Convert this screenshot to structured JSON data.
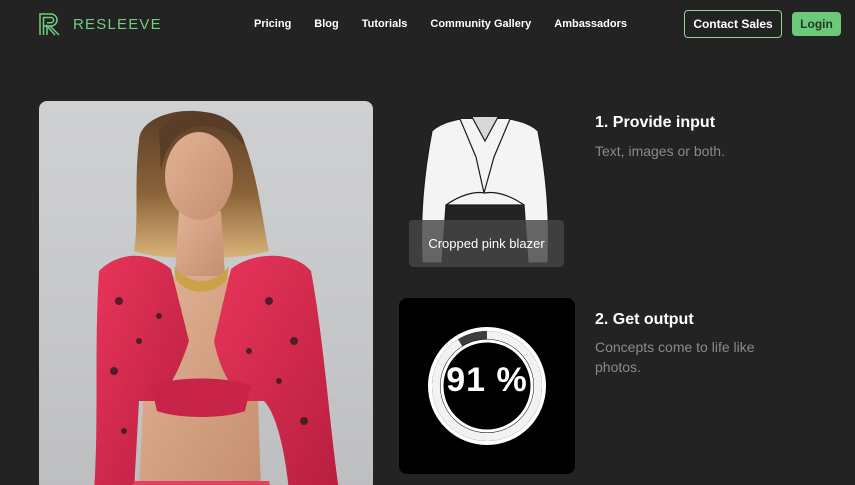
{
  "brand": {
    "name": "RESLEEVE",
    "accent_color": "#6cc97a",
    "logo_icon": "resleeve-r-logo-icon"
  },
  "nav": {
    "items": [
      {
        "label": "Pricing"
      },
      {
        "label": "Blog"
      },
      {
        "label": "Tutorials"
      },
      {
        "label": "Community Gallery"
      },
      {
        "label": "Ambassadors"
      }
    ]
  },
  "header_actions": {
    "contact_label": "Contact Sales",
    "login_label": "Login"
  },
  "steps": [
    {
      "title": "1. Provide input",
      "description": "Text, images or both.",
      "input_label": "Cropped pink blazer",
      "sketch_icon": "blazer-sketch"
    },
    {
      "title": "2. Get output",
      "description": "Concepts come to life like photos.",
      "progress_text": "91 %",
      "progress_fraction": 0.91
    }
  ],
  "hero": {
    "image": "model-in-pink-cropped-blazer"
  }
}
